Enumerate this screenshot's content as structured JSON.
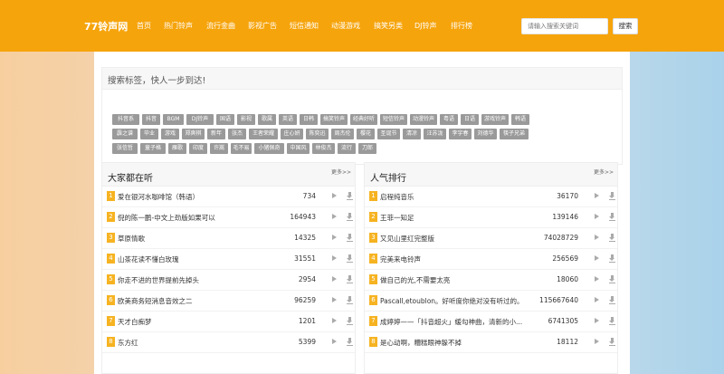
{
  "header": {
    "logo": "77铃声网",
    "nav": [
      "首页",
      "热门铃声",
      "流行金曲",
      "影视广告",
      "短信通知",
      "动漫游戏",
      "搞笑另类",
      "DJ铃声",
      "排行榜"
    ],
    "search_placeholder": "请输入搜索关键词",
    "search_button": "搜索"
  },
  "tags": {
    "title": "搜索标签，快人一步到达!",
    "items": [
      "抖音系",
      "抖音",
      "BGM",
      "DJ铃声",
      "国语",
      "影视",
      "歌属",
      "英语",
      "日韩",
      "搞笑铃声",
      "经典好听",
      "短信铃声",
      "动漫铃声",
      "粤语",
      "日语",
      "游戏铃声",
      "韩语",
      "霹之谱",
      "毕业",
      "游戏",
      "郑爽棋",
      "新年",
      "张杰",
      "王者荣耀",
      "庄心妍",
      "陈奕迅",
      "周杰伦",
      "樱花",
      "圣诞节",
      "清凉",
      "汪苏泷",
      "李宇春",
      "刘德华",
      "筷子兄弟",
      "张信哲",
      "童子格",
      "雁歌",
      "印度",
      "许嵩",
      "毛不易",
      "小猪佩奇",
      "中国风",
      "林俊杰",
      "流行",
      "刀郎"
    ]
  },
  "left_panel": {
    "title": "大家都在听",
    "more": "更多>>",
    "rows": [
      {
        "rank": "1",
        "name": "爱在银河水咖啡馆（韩语）",
        "count": "734"
      },
      {
        "rank": "2",
        "name": "倪的陈一鹏-中文上劲版如果可以",
        "count": "164943"
      },
      {
        "rank": "3",
        "name": "草原情歌",
        "count": "14325"
      },
      {
        "rank": "4",
        "name": "山茶花读不懂白玫瑰",
        "count": "31551"
      },
      {
        "rank": "5",
        "name": "你走不进的世界提前先掉头",
        "count": "2954"
      },
      {
        "rank": "6",
        "name": "欧美商务短消息音效之二",
        "count": "96259"
      },
      {
        "rank": "7",
        "name": "天才白痴梦",
        "count": "1201"
      },
      {
        "rank": "8",
        "name": "东方红",
        "count": "5399"
      }
    ]
  },
  "right_panel": {
    "title": "人气排行",
    "more": "更多>>",
    "rows": [
      {
        "rank": "1",
        "name": "启程纯音乐",
        "count": "36170"
      },
      {
        "rank": "2",
        "name": "王菲一知足",
        "count": "139146"
      },
      {
        "rank": "3",
        "name": "又见山里红完整版",
        "count": "74028729"
      },
      {
        "rank": "4",
        "name": "完美来电铃声",
        "count": "256569"
      },
      {
        "rank": "5",
        "name": "做自己的光,不需要太亮",
        "count": "18060"
      },
      {
        "rank": "6",
        "name": "Pascall,etoublon。好听度你绝对没有听过的。",
        "count": "115667640"
      },
      {
        "rank": "7",
        "name": "成婷婷——「抖音超火」缓勾神曲，清新的小...",
        "count": "6741305"
      },
      {
        "rank": "8",
        "name": "是心动啊，糟糕眼神躲不掉",
        "count": "18112"
      }
    ]
  }
}
